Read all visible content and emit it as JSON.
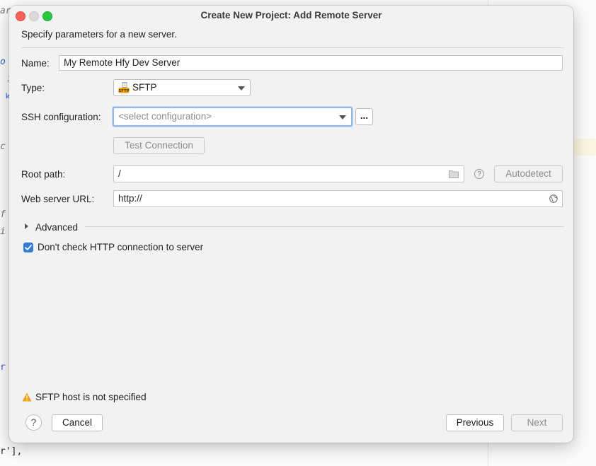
{
  "dialog": {
    "title": "Create New Project: Add Remote Server",
    "subtitle": "Specify parameters for a new server."
  },
  "form": {
    "name_label": "Name:",
    "name_value": "My Remote Hfy Dev Server",
    "type_label": "Type:",
    "type_value": "SFTP",
    "type_icon": "sftp-icon",
    "ssh_label": "SSH configuration:",
    "ssh_placeholder": "<select configuration>",
    "ssh_more_label": "...",
    "test_connection_label": "Test Connection",
    "root_path_label": "Root path:",
    "root_path_value": "/",
    "help_small": "?",
    "autodetect_label": "Autodetect",
    "web_url_label": "Web server URL:",
    "web_url_value": "http://",
    "advanced_label": "Advanced",
    "checkbox_label": "Don't check HTTP connection to server",
    "checkbox_checked": true
  },
  "footer": {
    "warning_text": "SFTP host is not specified",
    "help_label": "?",
    "cancel_label": "Cancel",
    "previous_label": "Previous",
    "next_label": "Next"
  },
  "background_code": {
    "l1": "ar",
    "l2": "o",
    "l3": "i",
    "l4": "w",
    "l5": "c",
    "l6": "f",
    "l7": "i",
    "l8": "r",
    "l9": "r'],"
  },
  "colors": {
    "accent": "#2f7de1",
    "warning": "#f0a30a",
    "close": "#fe5f57",
    "zoom": "#28c840"
  }
}
